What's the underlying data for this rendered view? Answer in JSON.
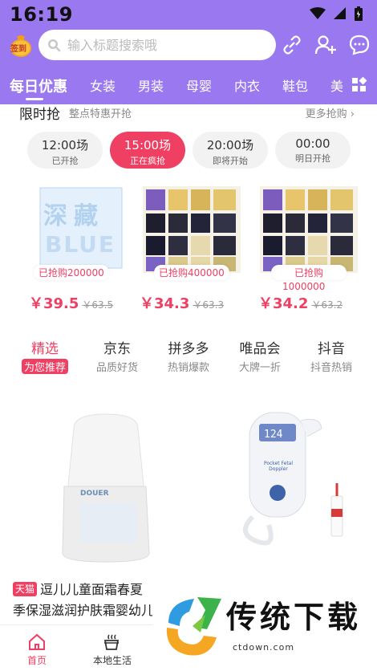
{
  "status": {
    "time": "16:19"
  },
  "header": {
    "sign_label": "签到",
    "search_placeholder": "输入标题搜索哦",
    "categories": [
      "每日优惠",
      "女装",
      "男装",
      "母婴",
      "内衣",
      "鞋包",
      "美"
    ]
  },
  "flash_sale": {
    "title": "限时抢",
    "subtitle": "整点特惠开抢",
    "more": "更多抢购",
    "slots": [
      {
        "time": "12:00场",
        "status": "已开抢"
      },
      {
        "time": "15:00场",
        "status": "正在疯抢"
      },
      {
        "time": "20:00场",
        "status": "即将开始"
      },
      {
        "time": "00:00",
        "status": "明日开抢"
      }
    ],
    "products": [
      {
        "sold": "已抢购200000",
        "price": "￥39.5",
        "old_price": "￥63.5",
        "image_text": [
          "深藏",
          "BLUE"
        ]
      },
      {
        "sold": "已抢购400000",
        "price": "￥34.3",
        "old_price": "￥63.3"
      },
      {
        "sold": "已抢购",
        "sold_count": "1000000",
        "price": "￥34.2",
        "old_price": "￥63.2"
      }
    ]
  },
  "platform_tabs": [
    {
      "name": "精选",
      "desc": "为您推荐"
    },
    {
      "name": "京东",
      "desc": "品质好货"
    },
    {
      "name": "拼多多",
      "desc": "热销爆款"
    },
    {
      "name": "唯品会",
      "desc": "大牌一折"
    },
    {
      "name": "抖音",
      "desc": "抖音热销"
    }
  ],
  "feed": {
    "item1": {
      "tag": "天猫",
      "title": "逗儿儿童面霜春夏季保湿滋润护肤霜婴幼儿宝",
      "brand_text": "DOUER"
    },
    "item2": {
      "device_reading": "124",
      "device_label": "Pocket Fetal Doppler"
    }
  },
  "bottom_nav": [
    {
      "label": "首页"
    },
    {
      "label": "本地生活"
    }
  ],
  "watermark": {
    "text": "传统下载",
    "url": "ctdown.com"
  },
  "colors": {
    "header": "#9a78f0",
    "accent": "#ef3f63"
  }
}
